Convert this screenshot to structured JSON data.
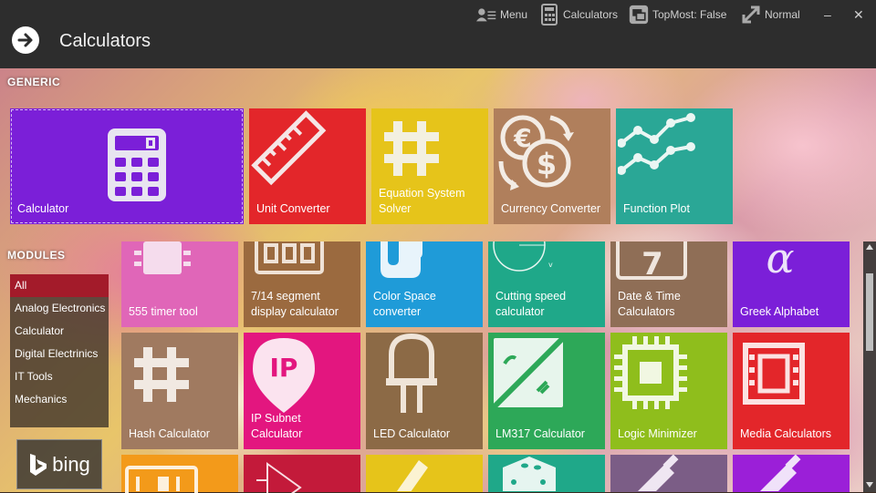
{
  "titlebar": {
    "menu_label": "Menu",
    "calculators_label": "Calculators",
    "topmost_label": "TopMost: False",
    "normal_label": "Normal",
    "minimize_label": "–",
    "close_label": "✕"
  },
  "header": {
    "title": "Calculators"
  },
  "generic": {
    "heading": "GENERIC",
    "tiles": [
      {
        "label": "Calculator",
        "color": "#7b1fd8"
      },
      {
        "label": "Unit Converter",
        "color": "#e3262a"
      },
      {
        "label": "Equation System Solver",
        "color": "#e6c41a"
      },
      {
        "label": "Currency Converter",
        "color": "#b07f5c"
      },
      {
        "label": "Function Plot",
        "color": "#2aa796"
      }
    ]
  },
  "modules": {
    "heading": "MODULES",
    "items": [
      "All",
      "Analog Electronics",
      "Calculator",
      "Digital Electrinics",
      "IT Tools",
      "Mechanics"
    ],
    "bing_label": "bing"
  },
  "grid": {
    "row1": [
      {
        "label": "555 timer tool",
        "color": "#e066b8"
      },
      {
        "label": "7/14 segment display calculator",
        "color": "#9b6a3f"
      },
      {
        "label": "Color Space converter",
        "color": "#1f9bd8"
      },
      {
        "label": "Cutting speed calculator",
        "color": "#1fa889"
      },
      {
        "label": "Date & Time Calculators",
        "color": "#8f6e56"
      },
      {
        "label": "Greek Alphabet",
        "color": "#7b1fd8"
      }
    ],
    "row2": [
      {
        "label": "Hash Calculator",
        "color": "#a07a60"
      },
      {
        "label": "IP Subnet Calculator",
        "color": "#e3167f"
      },
      {
        "label": "LED Calculator",
        "color": "#8c6a46"
      },
      {
        "label": "LM317 Calculator",
        "color": "#2da858"
      },
      {
        "label": "Logic Minimizer",
        "color": "#8fbe1c"
      },
      {
        "label": "Media Calculators",
        "color": "#e3262a"
      }
    ],
    "row3": [
      {
        "label": "",
        "color": "#f39a1a"
      },
      {
        "label": "",
        "color": "#c31a3a"
      },
      {
        "label": "",
        "color": "#e6c41a"
      },
      {
        "label": "",
        "color": "#1fa889"
      },
      {
        "label": "",
        "color": "#7b5d86"
      },
      {
        "label": "",
        "color": "#9b1fd8"
      }
    ]
  }
}
